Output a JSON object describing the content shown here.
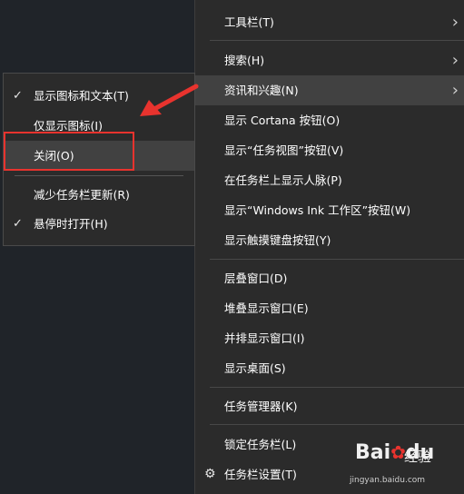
{
  "main_menu": {
    "items": [
      {
        "label": "工具栏(T)",
        "has_submenu": true
      },
      {
        "label": "搜索(H)",
        "has_submenu": true
      },
      {
        "label": "资讯和兴趣(N)",
        "has_submenu": true,
        "highlighted": true
      },
      {
        "label": "显示 Cortana 按钮(O)"
      },
      {
        "label": "显示“任务视图”按钮(V)"
      },
      {
        "label": "在任务栏上显示人脉(P)"
      },
      {
        "label": "显示“Windows Ink 工作区”按钮(W)"
      },
      {
        "label": "显示触摸键盘按钮(Y)"
      },
      {
        "label": "层叠窗口(D)"
      },
      {
        "label": "堆叠显示窗口(E)"
      },
      {
        "label": "并排显示窗口(I)"
      },
      {
        "label": "显示桌面(S)"
      },
      {
        "label": "任务管理器(K)"
      },
      {
        "label": "锁定任务栏(L)"
      },
      {
        "label": "任务栏设置(T)",
        "icon": "gear-icon"
      }
    ],
    "chevron": "›"
  },
  "sub_menu": {
    "items": [
      {
        "label": "显示图标和文本(T)",
        "checked": true
      },
      {
        "label": "仅显示图标(I)",
        "checked": false
      },
      {
        "label": "关闭(O)",
        "checked": false,
        "highlighted": true
      },
      {
        "label": "减少任务栏更新(R)",
        "checked": false
      },
      {
        "label": "悬停时打开(H)",
        "checked": true
      }
    ],
    "check_glyph": "✓"
  },
  "annotation": {
    "arrow_color": "#e8332e",
    "box_color": "#e8332e"
  },
  "watermark": {
    "brand": "Bai",
    "brand_suffix": "du",
    "label": "经验",
    "url": "jingyan.baidu.com"
  }
}
